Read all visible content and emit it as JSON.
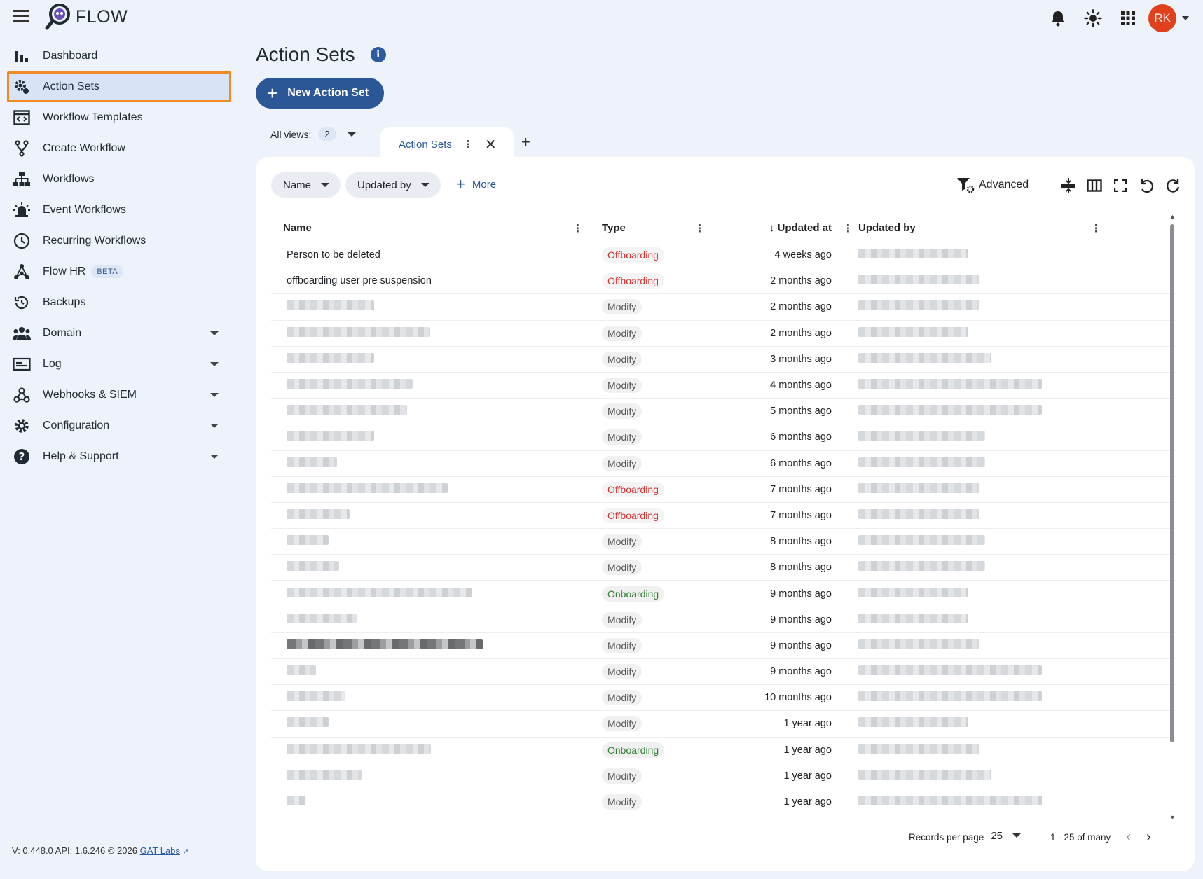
{
  "app": {
    "name": "FLOW"
  },
  "header": {
    "avatar_initials": "RK",
    "icons": [
      "bell-icon",
      "brightness-icon",
      "apps-grid-icon"
    ]
  },
  "sidebar": {
    "items": [
      {
        "label": "Dashboard",
        "icon": "bar-chart-icon"
      },
      {
        "label": "Action Sets",
        "icon": "gear-action-icon",
        "active": true
      },
      {
        "label": "Workflow Templates",
        "icon": "template-icon"
      },
      {
        "label": "Create Workflow",
        "icon": "fork-icon"
      },
      {
        "label": "Workflows",
        "icon": "hierarchy-icon"
      },
      {
        "label": "Event Workflows",
        "icon": "alarm-icon"
      },
      {
        "label": "Recurring Workflows",
        "icon": "clock-icon"
      },
      {
        "label": "Flow HR",
        "icon": "nodes-icon",
        "badge": "BETA"
      },
      {
        "label": "Backups",
        "icon": "restore-icon"
      },
      {
        "label": "Domain",
        "icon": "people-icon",
        "expandable": true
      },
      {
        "label": "Log",
        "icon": "log-icon",
        "expandable": true
      },
      {
        "label": "Webhooks & SIEM",
        "icon": "webhook-icon",
        "expandable": true
      },
      {
        "label": "Configuration",
        "icon": "gear-icon",
        "expandable": true
      },
      {
        "label": "Help & Support",
        "icon": "help-icon",
        "expandable": true
      }
    ],
    "footer": {
      "text": "V: 0.448.0   API: 1.6.246   © 2026 ",
      "link": "GAT Labs"
    }
  },
  "page": {
    "title": "Action Sets",
    "new_button": "New Action Set",
    "views": {
      "label": "All views:",
      "count": "2",
      "active_tab": "Action Sets"
    }
  },
  "toolbar": {
    "filters": [
      "Name",
      "Updated by"
    ],
    "more": "More",
    "advanced": "Advanced"
  },
  "table": {
    "columns": [
      "Name",
      "Type",
      "Updated at",
      "Updated by"
    ],
    "rows": [
      {
        "name": "Person to be deleted",
        "type": "Offboarding",
        "updated_at": "4 weeks ago"
      },
      {
        "name": "offboarding user pre suspension",
        "type": "Offboarding",
        "updated_at": "2 months ago"
      },
      {
        "name": "",
        "type": "Modify",
        "updated_at": "2 months ago"
      },
      {
        "name": "",
        "type": "Modify",
        "updated_at": "2 months ago"
      },
      {
        "name": "",
        "type": "Modify",
        "updated_at": "3 months ago"
      },
      {
        "name": "",
        "type": "Modify",
        "updated_at": "4 months ago"
      },
      {
        "name": "",
        "type": "Modify",
        "updated_at": "5 months ago"
      },
      {
        "name": "",
        "type": "Modify",
        "updated_at": "6 months ago"
      },
      {
        "name": "",
        "type": "Modify",
        "updated_at": "6 months ago"
      },
      {
        "name": "",
        "type": "Offboarding",
        "updated_at": "7 months ago"
      },
      {
        "name": "",
        "type": "Offboarding",
        "updated_at": "7 months ago"
      },
      {
        "name": "",
        "type": "Modify",
        "updated_at": "8 months ago"
      },
      {
        "name": "",
        "type": "Modify",
        "updated_at": "8 months ago"
      },
      {
        "name": "",
        "type": "Onboarding",
        "updated_at": "9 months ago"
      },
      {
        "name": "",
        "type": "Modify",
        "updated_at": "9 months ago"
      },
      {
        "name": "",
        "type": "Modify",
        "updated_at": "9 months ago"
      },
      {
        "name": "",
        "type": "Modify",
        "updated_at": "9 months ago"
      },
      {
        "name": "",
        "type": "Modify",
        "updated_at": "10 months ago"
      },
      {
        "name": "",
        "type": "Modify",
        "updated_at": "1 year ago"
      },
      {
        "name": "",
        "type": "Onboarding",
        "updated_at": "1 year ago"
      },
      {
        "name": "",
        "type": "Modify",
        "updated_at": "1 year ago"
      },
      {
        "name": "",
        "type": "Modify",
        "updated_at": "1 year ago"
      }
    ]
  },
  "pagination": {
    "label": "Records per page",
    "per_page": "25",
    "range": "1 - 25 of many"
  },
  "colors": {
    "primary": "#2b5797",
    "avatar": "#e0401b",
    "highlight": "#f08a24",
    "offboarding": "#d32f2f",
    "onboarding": "#2e7d32"
  }
}
